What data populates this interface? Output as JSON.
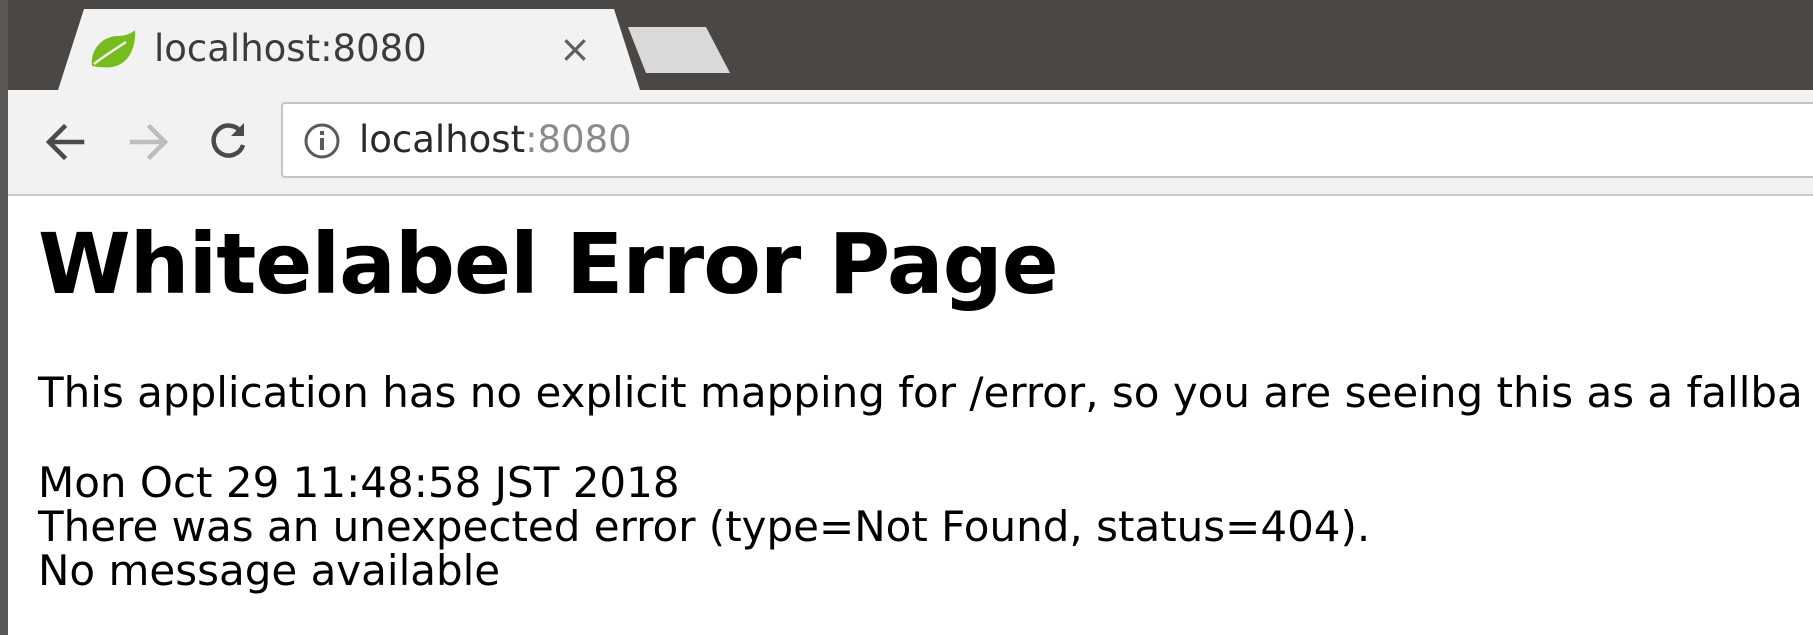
{
  "browser": {
    "tab": {
      "title": "localhost:8080",
      "favicon": "spring-leaf-icon",
      "close_glyph": "×"
    },
    "toolbar": {
      "back_icon": "back-arrow-icon",
      "forward_icon": "forward-arrow-icon",
      "reload_icon": "reload-icon",
      "info_icon": "info-icon",
      "url_host": "localhost",
      "url_port": ":8080"
    },
    "colors": {
      "tabstrip": "#4a4745",
      "toolbar": "#f2f2f2",
      "favicon_green": "#77bc1f"
    }
  },
  "page": {
    "title": "Whitelabel Error Page",
    "description": "This application has no explicit mapping for /error, so you are seeing this as a fallba",
    "timestamp": "Mon Oct 29 11:48:58 JST 2018",
    "error_line": "There was an unexpected error (type=Not Found, status=404).",
    "message": "No message available"
  }
}
